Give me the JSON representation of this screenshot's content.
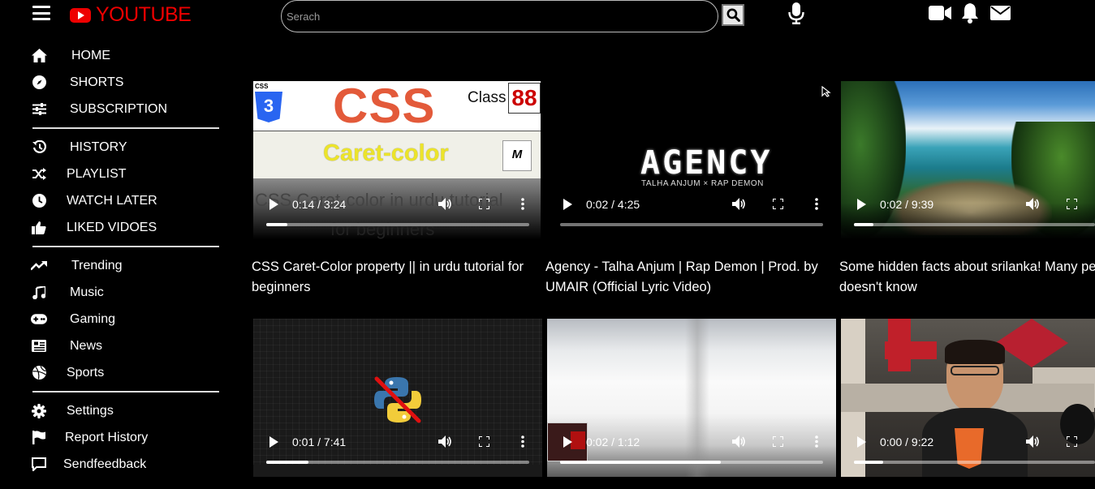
{
  "header": {
    "brand": "YOUTUBE",
    "search_placeholder": "Serach",
    "menu_icon": "hamburger-menu-icon",
    "brand_color": "#e00000"
  },
  "sidebar": {
    "group1": [
      {
        "label": "HOME",
        "icon": "home-icon"
      },
      {
        "label": "SHORTS",
        "icon": "compass-icon"
      },
      {
        "label": "SUBSCRIPTION",
        "icon": "sliders-icon"
      }
    ],
    "group2": [
      {
        "label": "HISTORY",
        "icon": "history-icon"
      },
      {
        "label": "PLAYLIST",
        "icon": "shuffle-icon"
      },
      {
        "label": "WATCH LATER",
        "icon": "clock-icon"
      },
      {
        "label": "LIKED VIDOES",
        "icon": "thumbs-up-icon"
      }
    ],
    "group3": [
      {
        "label": "Trending",
        "icon": "trending-icon"
      },
      {
        "label": "Music",
        "icon": "music-icon"
      },
      {
        "label": "Gaming",
        "icon": "gamepad-icon"
      },
      {
        "label": "News",
        "icon": "newspaper-icon"
      },
      {
        "label": "Sports",
        "icon": "basketball-icon"
      }
    ],
    "group4": [
      {
        "label": "Settings",
        "icon": "gear-icon"
      },
      {
        "label": "Report History",
        "icon": "flag-icon"
      },
      {
        "label": "Sendfeedback",
        "icon": "feedback-icon"
      }
    ]
  },
  "videos": [
    {
      "time": "0:14 / 3:24",
      "progress": 0.08,
      "title": "CSS Caret-Color property || in urdu tutorial for beginners",
      "thumb_texts": {
        "css": "CSS",
        "class": "Class",
        "num": "88",
        "caret": "Caret-color",
        "css3": "CSS",
        "overlay_top": "CSS Caret-color in urdu tutorial",
        "overlay_bottom": "for beginners"
      }
    },
    {
      "time": "0:02 / 4:25",
      "progress": 0.0,
      "title": "Agency - Talha Anjum | Rap Demon | Prod. by UMAIR (Official Lyric Video)",
      "thumb_texts": {
        "agency": "AGENCY",
        "sub": "TALHA ANJUM × RAP DEMON"
      }
    },
    {
      "time": "0:02 / 9:39",
      "progress": 0.08,
      "title": "Some hidden facts about srilanka! Many people doesn't know"
    },
    {
      "time": "0:01 / 7:41",
      "progress": 0.16
    },
    {
      "time": "0:02 / 1:12",
      "progress": 0.61
    },
    {
      "time": "0:00 / 9:22",
      "progress": 0.12
    }
  ]
}
